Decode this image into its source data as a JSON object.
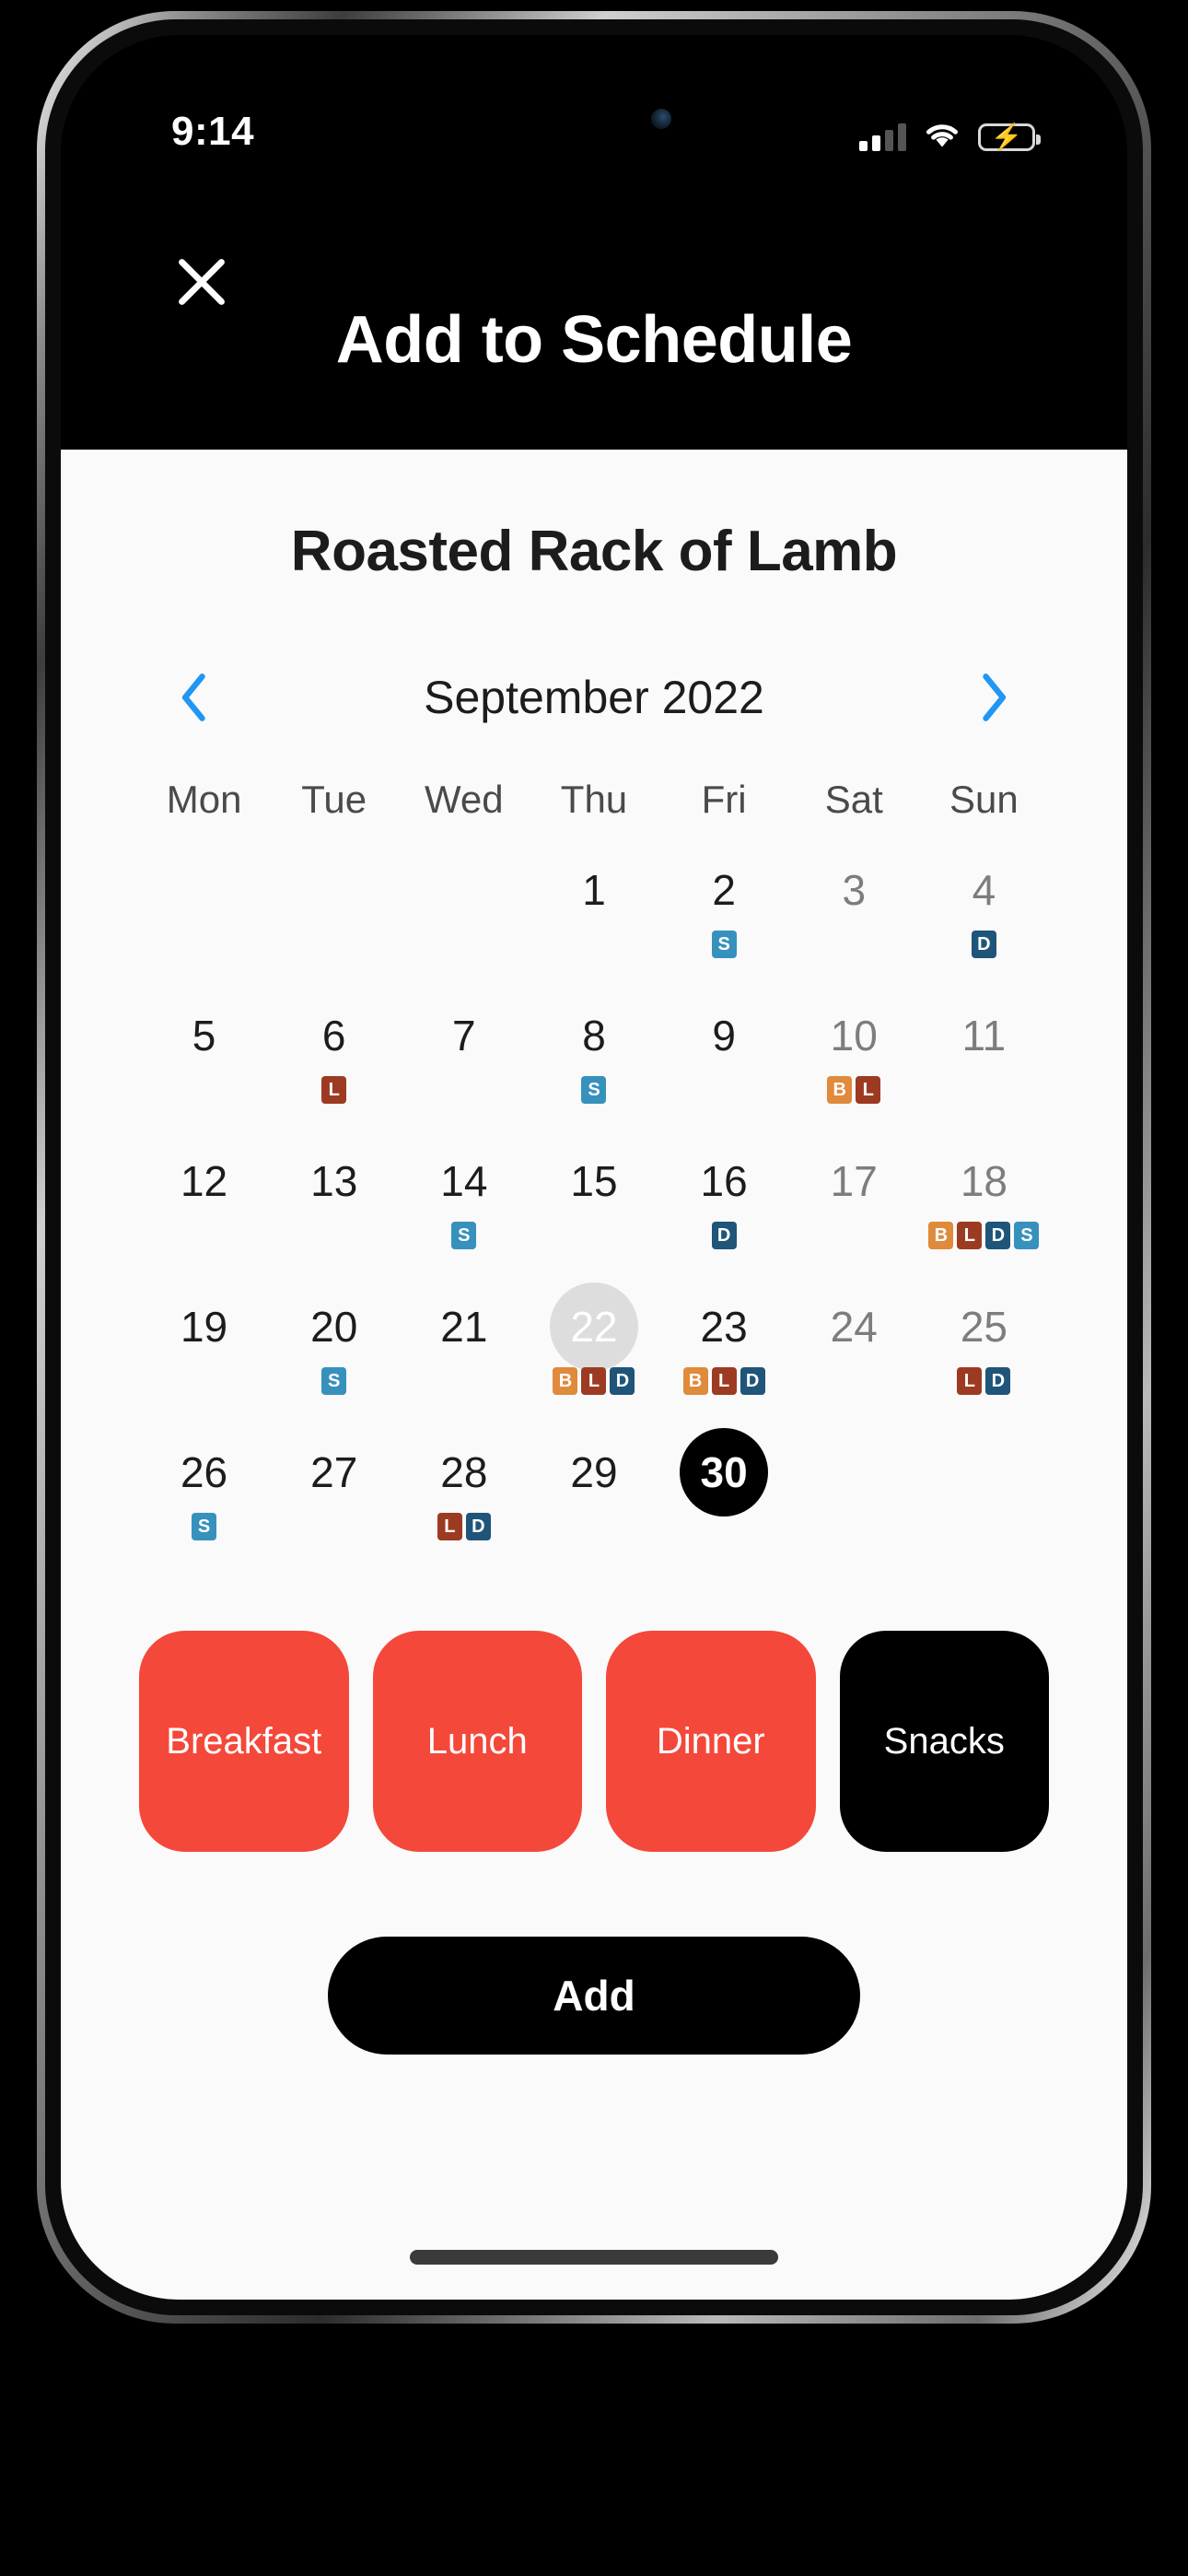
{
  "status_bar": {
    "time": "9:14",
    "cellular_icon": "cellular-signal-icon",
    "wifi_icon": "wifi-icon",
    "battery_icon": "battery-charging-icon",
    "battery_color": "#2ed04a"
  },
  "header": {
    "close_icon": "close-icon",
    "title": "Add to Schedule",
    "background": "#000000"
  },
  "recipe": {
    "title": "Roasted Rack of Lamb"
  },
  "calendar": {
    "prev_icon": "chevron-left-icon",
    "next_icon": "chevron-right-icon",
    "month_label": "September 2022",
    "accent": "#2196f3",
    "weekdays": [
      "Mon",
      "Tue",
      "Wed",
      "Thu",
      "Fri",
      "Sat",
      "Sun"
    ],
    "badge_colors": {
      "B": "#e08a3c",
      "L": "#9c3b22",
      "D": "#1f5579",
      "S": "#3791bd"
    },
    "today": 22,
    "selected": 30,
    "weeks": [
      [
        {
          "day": "",
          "state": "empty",
          "badges": []
        },
        {
          "day": "",
          "state": "empty",
          "badges": []
        },
        {
          "day": "",
          "state": "empty",
          "badges": []
        },
        {
          "day": "1",
          "state": "normal",
          "badges": []
        },
        {
          "day": "2",
          "state": "normal",
          "badges": [
            "S"
          ]
        },
        {
          "day": "3",
          "state": "dim",
          "badges": []
        },
        {
          "day": "4",
          "state": "dim",
          "badges": [
            "D"
          ]
        }
      ],
      [
        {
          "day": "5",
          "state": "normal",
          "badges": []
        },
        {
          "day": "6",
          "state": "normal",
          "badges": [
            "L"
          ]
        },
        {
          "day": "7",
          "state": "normal",
          "badges": []
        },
        {
          "day": "8",
          "state": "normal",
          "badges": [
            "S"
          ]
        },
        {
          "day": "9",
          "state": "normal",
          "badges": []
        },
        {
          "day": "10",
          "state": "dim",
          "badges": [
            "B",
            "L"
          ]
        },
        {
          "day": "11",
          "state": "dim",
          "badges": []
        }
      ],
      [
        {
          "day": "12",
          "state": "normal",
          "badges": []
        },
        {
          "day": "13",
          "state": "normal",
          "badges": []
        },
        {
          "day": "14",
          "state": "normal",
          "badges": [
            "S"
          ]
        },
        {
          "day": "15",
          "state": "normal",
          "badges": []
        },
        {
          "day": "16",
          "state": "normal",
          "badges": [
            "D"
          ]
        },
        {
          "day": "17",
          "state": "dim",
          "badges": []
        },
        {
          "day": "18",
          "state": "dim",
          "badges": [
            "B",
            "L",
            "D",
            "S"
          ]
        }
      ],
      [
        {
          "day": "19",
          "state": "normal",
          "badges": []
        },
        {
          "day": "20",
          "state": "normal",
          "badges": [
            "S"
          ]
        },
        {
          "day": "21",
          "state": "normal",
          "badges": []
        },
        {
          "day": "22",
          "state": "today",
          "badges": [
            "B",
            "L",
            "D"
          ]
        },
        {
          "day": "23",
          "state": "normal",
          "badges": [
            "B",
            "L",
            "D"
          ]
        },
        {
          "day": "24",
          "state": "dim",
          "badges": []
        },
        {
          "day": "25",
          "state": "dim",
          "badges": [
            "L",
            "D"
          ]
        }
      ],
      [
        {
          "day": "26",
          "state": "normal",
          "badges": [
            "S"
          ]
        },
        {
          "day": "27",
          "state": "normal",
          "badges": []
        },
        {
          "day": "28",
          "state": "normal",
          "badges": [
            "L",
            "D"
          ]
        },
        {
          "day": "29",
          "state": "normal",
          "badges": []
        },
        {
          "day": "30",
          "state": "selected",
          "badges": []
        },
        {
          "day": "",
          "state": "empty",
          "badges": []
        },
        {
          "day": "",
          "state": "empty",
          "badges": []
        }
      ]
    ]
  },
  "meals": {
    "unselected_color": "#f4483a",
    "selected_color": "#000000",
    "options": [
      {
        "label": "Breakfast",
        "selected": false
      },
      {
        "label": "Lunch",
        "selected": false
      },
      {
        "label": "Dinner",
        "selected": false
      },
      {
        "label": "Snacks",
        "selected": true
      }
    ]
  },
  "actions": {
    "add_label": "Add"
  }
}
